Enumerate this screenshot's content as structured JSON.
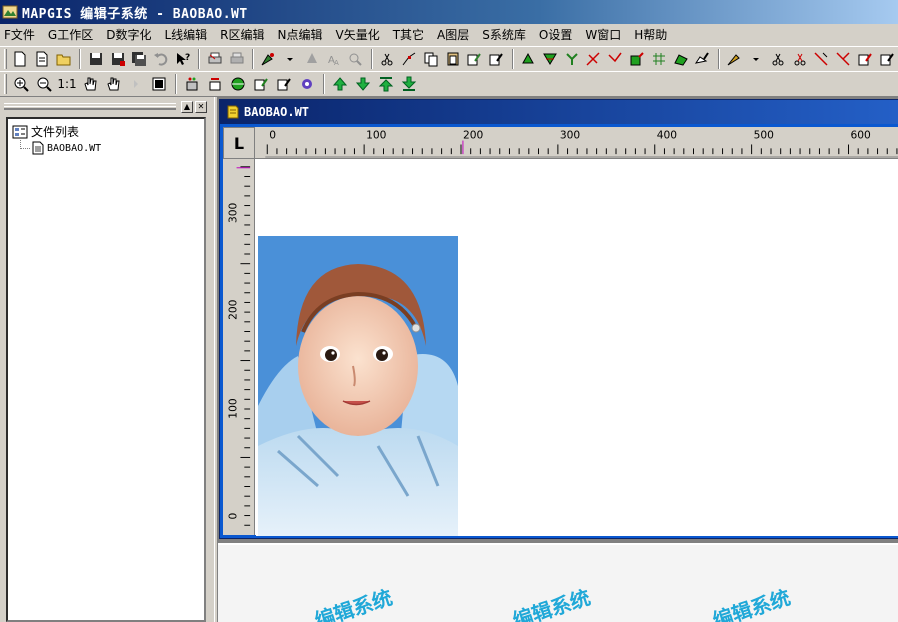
{
  "app": {
    "title": "MAPGIS 编辑子系统 - BAOBAO.WT"
  },
  "menu": [
    {
      "id": "file",
      "label": "F文件"
    },
    {
      "id": "workspace",
      "label": "G工作区"
    },
    {
      "id": "digitize",
      "label": "D数字化"
    },
    {
      "id": "line-edit",
      "label": "L线编辑"
    },
    {
      "id": "area-edit",
      "label": "R区编辑"
    },
    {
      "id": "point-edit",
      "label": "N点编辑"
    },
    {
      "id": "vectorize",
      "label": "V矢量化"
    },
    {
      "id": "other",
      "label": "T其它"
    },
    {
      "id": "layer",
      "label": "A图层"
    },
    {
      "id": "library",
      "label": "S系统库"
    },
    {
      "id": "settings",
      "label": "O设置"
    },
    {
      "id": "window",
      "label": "W窗口"
    },
    {
      "id": "help",
      "label": "H帮助"
    }
  ],
  "toolbar": {
    "zoom_ratio_label": "1:1"
  },
  "left_panel": {
    "tree_root_label": "文件列表",
    "tree_items": [
      "BAOBAO.WT"
    ]
  },
  "document": {
    "title": "BAOBAO.WT",
    "ruler_corner": "L",
    "ruler_h_labels": [
      "0",
      "100",
      "200",
      "300",
      "400",
      "500",
      "600"
    ],
    "ruler_v_labels": [
      "300",
      "200",
      "100",
      "0"
    ]
  },
  "watermarks": [
    "编辑系统",
    "编辑系统",
    "编辑系统"
  ],
  "colors": {
    "title_bar": "#0a246a",
    "doc_frame": "#0a58d0",
    "photo_bg": "#4a90d8",
    "watermark": "#20a8d8"
  }
}
